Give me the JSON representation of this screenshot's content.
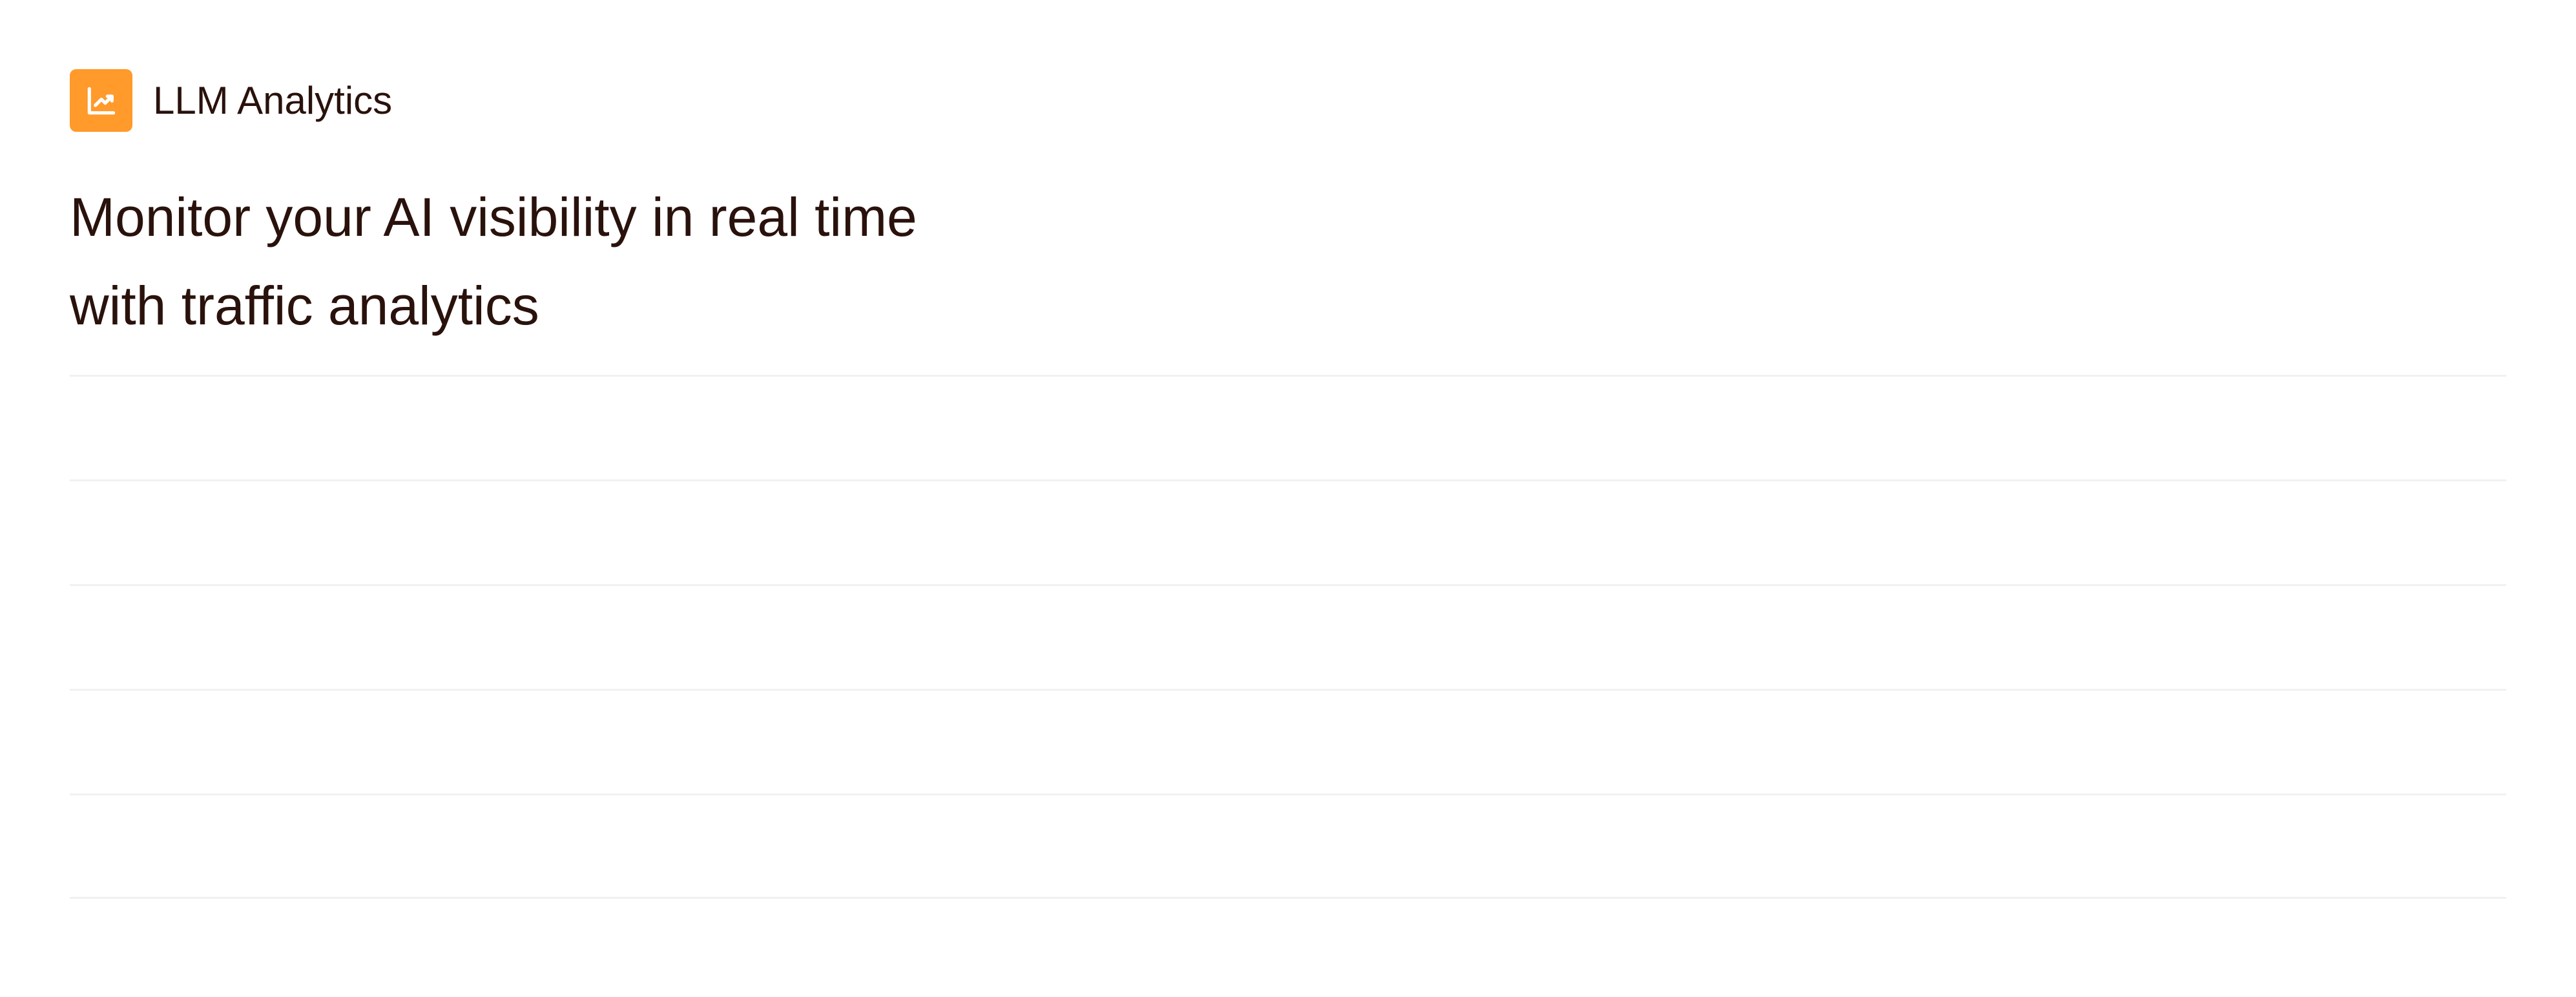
{
  "brand": {
    "name": "LLM Analytics",
    "icon": "chart-line-up-icon",
    "accent_color": "#ff9a2b"
  },
  "headline": {
    "text": "Monitor your AI visibility in real time with traffic analytics"
  },
  "rows": [
    {
      "text": ""
    },
    {
      "text": ""
    },
    {
      "text": ""
    },
    {
      "text": ""
    },
    {
      "text": ""
    }
  ]
}
